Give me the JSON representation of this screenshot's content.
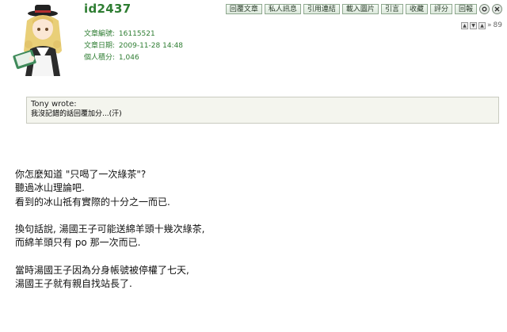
{
  "post": {
    "username": "id2437",
    "meta": [
      {
        "label": "文章編號:",
        "value": "16115521"
      },
      {
        "label": "文章日期:",
        "value": "2009-11-28 14:48"
      },
      {
        "label": "個人積分:",
        "value": "1,046"
      }
    ],
    "toolbar": [
      "回覆文章",
      "私人訊息",
      "引用連結",
      "載入圖片",
      "引言",
      "收藏",
      "評分",
      "回報"
    ],
    "toolbar_icons": [
      "settings-icon",
      "close-icon"
    ],
    "floor_number": "89",
    "quote": {
      "author": "Tony wrote:",
      "text": "我沒記錯的話回覆加分...(汗)"
    },
    "body_lines": [
      "你怎麼知道 \"只喝了一次綠茶\"?",
      "聽過冰山理論吧.",
      "看到的冰山祗有實際的十分之一而已.",
      "",
      "換句話說, 湯國王子可能送綿羊頭十幾次綠茶,",
      "而綿羊頭只有 po 那一次而已.",
      "",
      "當時湯國王子因為分身帳號被停權了七天,",
      "湯國王子就有親自找站長了."
    ]
  },
  "colors": {
    "username": "#2e7d32",
    "meta": "#2e7d32",
    "quote_bg": "#f4f5ee",
    "quote_border": "#c9cbc0"
  }
}
